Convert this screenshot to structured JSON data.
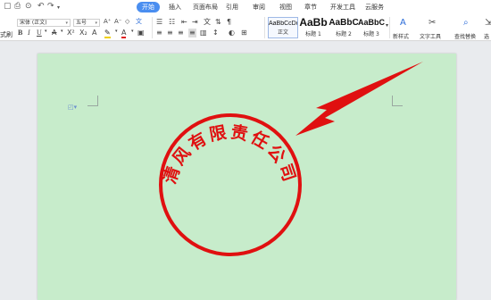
{
  "menu": {
    "tabs": [
      {
        "label": "开始",
        "active": true
      },
      {
        "label": "插入"
      },
      {
        "label": "页面布局"
      },
      {
        "label": "引用"
      },
      {
        "label": "审阅"
      },
      {
        "label": "视图"
      },
      {
        "label": "章节"
      },
      {
        "label": "开发工具"
      },
      {
        "label": "云服务"
      }
    ]
  },
  "ribbon": {
    "format_painter_label": "式刷",
    "font_name": "宋体 (正文)",
    "font_size": "五号",
    "styles": [
      {
        "sample": "AaBbCcDd",
        "name": "正文"
      },
      {
        "sample": "AaBb",
        "name": "标题 1"
      },
      {
        "sample": "AaBbC",
        "name": "标题 2"
      },
      {
        "sample": "AaBbC",
        "name": "标题 3"
      }
    ],
    "new_style_label": "新样式",
    "text_tools_label": "文字工具",
    "find_replace_label": "查找替换",
    "select_label": "选"
  },
  "document": {
    "seal_text": "清风有限责任公司"
  },
  "colors": {
    "accent": "#4a8ef0",
    "page_bg": "#c7eccb",
    "seal_red": "#e01010"
  }
}
